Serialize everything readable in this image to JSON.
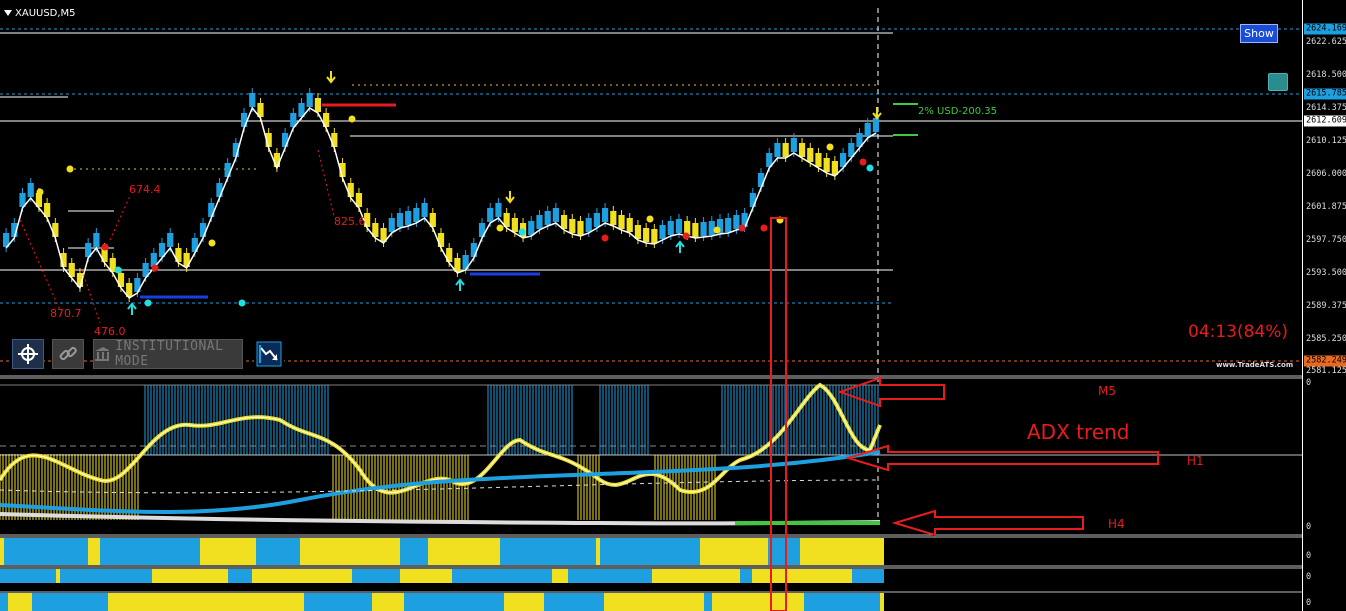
{
  "chart": {
    "symbol": "XAUUSD,M5",
    "show_button": "Show",
    "timer": "04:13(84%)",
    "risk_label": "2% USD-200.35",
    "watermark": "www.TradeATS.com",
    "institutional_mode": "INSTITUTIONAL MODE",
    "price_ticks": [
      "2622.625",
      "2618.500",
      "2614.375",
      "2610.125",
      "2606.000",
      "2601.875",
      "2597.750",
      "2593.500",
      "2589.375",
      "2585.250",
      "2581.125"
    ],
    "badges": {
      "top": "2624.169",
      "mid": "2615.785",
      "current": "2612.609",
      "low": "2582.249"
    },
    "level_labels": [
      "674.4",
      "825.6",
      "870.7",
      "476.0"
    ],
    "adx_title": "ADX trend",
    "timeframes": [
      "M5",
      "H1",
      "H4"
    ],
    "indicator_ticks": [
      "0",
      "0",
      "0",
      "0",
      "0"
    ],
    "colors": {
      "bull": "#1e9fe0",
      "bear": "#f0e020",
      "accent_red": "#e81c1c",
      "signal_green": "#3ec93e"
    },
    "icons": [
      "crosshair-icon",
      "link-icon",
      "bank-icon",
      "chart-arrow-icon"
    ]
  }
}
